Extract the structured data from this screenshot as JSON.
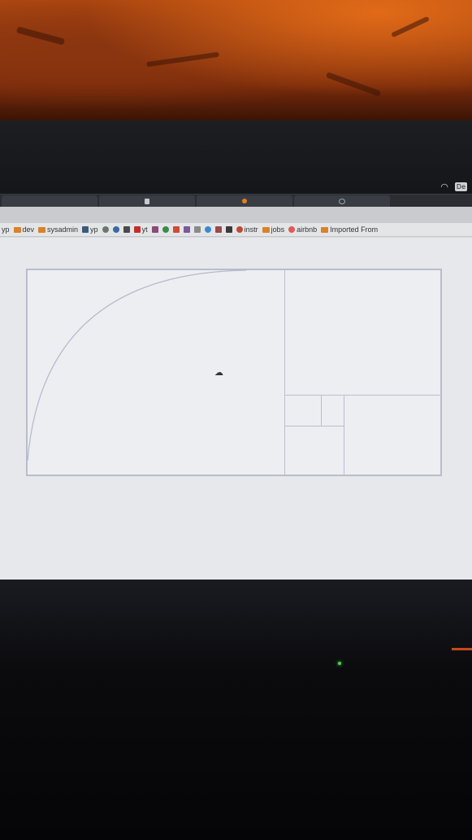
{
  "bookmarks_bar": {
    "items": [
      {
        "label": "yp",
        "icon": "none"
      },
      {
        "label": "dev",
        "icon": "folder-icon"
      },
      {
        "label": "sysadmin",
        "icon": "folder-icon"
      },
      {
        "label": "yp",
        "icon": "square-icon"
      },
      {
        "label": "",
        "icon": "whatsapp-icon"
      },
      {
        "label": "",
        "icon": "telegram-icon"
      },
      {
        "label": "",
        "icon": "square-icon"
      },
      {
        "label": "yt",
        "icon": "youtube-icon"
      },
      {
        "label": "",
        "icon": "app-icon"
      },
      {
        "label": "",
        "icon": "app-icon"
      },
      {
        "label": "",
        "icon": "app-icon"
      },
      {
        "label": "",
        "icon": "app-icon"
      },
      {
        "label": "",
        "icon": "app-icon"
      },
      {
        "label": "",
        "icon": "twitter-icon"
      },
      {
        "label": "",
        "icon": "app-icon"
      },
      {
        "label": "",
        "icon": "app-icon"
      },
      {
        "label": "instr",
        "icon": "app-icon"
      },
      {
        "label": "jobs",
        "icon": "folder-icon"
      },
      {
        "label": "airbnb",
        "icon": "airbnb-icon"
      },
      {
        "label": "Imported From",
        "icon": "folder-icon"
      }
    ]
  },
  "system_tray": {
    "wifi_icon": "wifi-icon",
    "keyboard_indicator": "De"
  },
  "colors": {
    "wall": "#b24a10",
    "bezel": "#1d1e22",
    "page_bg": "#e6e8ec",
    "figure_stroke": "#b9bfcc",
    "folder": "#d8822a"
  }
}
